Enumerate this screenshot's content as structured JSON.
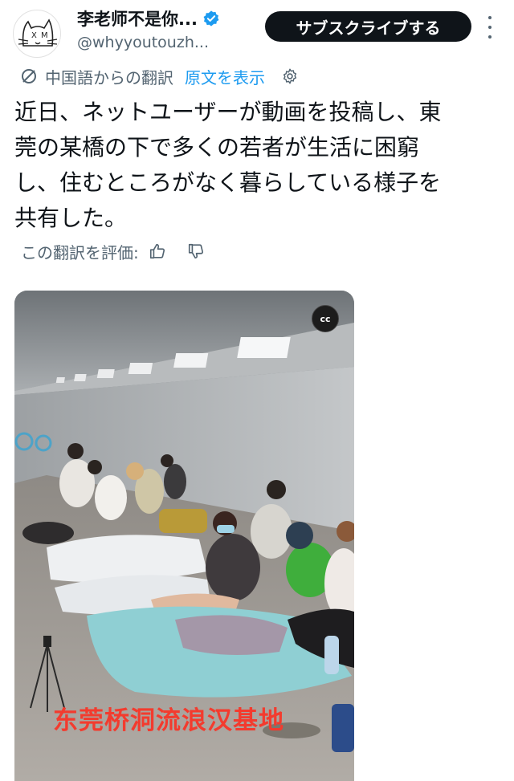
{
  "header": {
    "display_name": "李老师不是你...",
    "handle": "@whyyoutouzh...",
    "subscribe_label": "サブスクライブする",
    "verified_color": "#1d9bf0"
  },
  "translation": {
    "from_label": "中国語からの翻訳",
    "show_original_label": "原文を表示"
  },
  "tweet": {
    "lines": [
      "近日、ネットユーザーが動画を投稿し、東",
      "莞の某橋の下で多くの若者が生活に困窮",
      "し、住むところがなく暮らしている様子を",
      "共有した。"
    ]
  },
  "rating": {
    "label": "この翻訳を評価:"
  },
  "video": {
    "cc_label": "cc",
    "watermark": "东莞桥洞流浪汉基地"
  },
  "colors": {
    "accent": "#1d9bf0",
    "text": "#0f1419",
    "secondary": "#536471",
    "watermark": "#f33b2e"
  }
}
